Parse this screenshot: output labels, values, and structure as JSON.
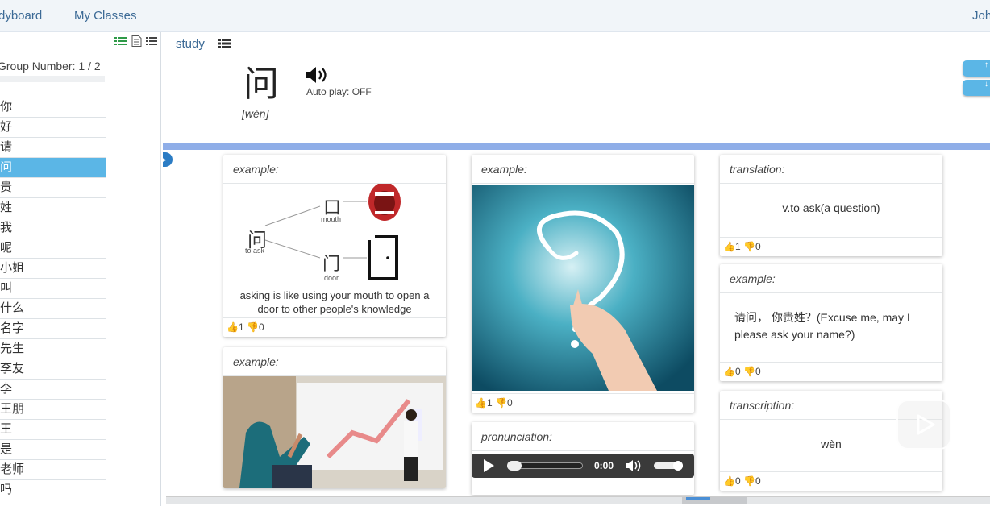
{
  "nav": {
    "dashboard": "dyboard",
    "my_classes": "My Classes",
    "user": "Joh"
  },
  "sidebar": {
    "group_label": "Group Number: 1 / 2",
    "words": [
      "你",
      "好",
      "请",
      "问",
      "贵",
      "姓",
      "我",
      "呢",
      "小姐",
      "叫",
      "什么",
      "名字",
      "先生",
      "李友",
      "李",
      "王朋",
      "王",
      "是",
      "老师",
      "吗"
    ],
    "active_index": 3
  },
  "study": {
    "link": "study",
    "character": "问",
    "pinyin": "[wèn]",
    "autoplay": "Auto play: OFF"
  },
  "cards": {
    "c1": {
      "head": "example:",
      "mouth_label": "mouth",
      "door_label": "door",
      "ask_label": "to ask",
      "char_wen": "问",
      "char_kou": "口",
      "char_men": "门",
      "caption": "asking is like using your mouth to open a door to other people's knowledge",
      "likes": "1",
      "dislikes": "0"
    },
    "c2": {
      "head": "example:"
    },
    "c3": {
      "head": "example:",
      "likes": "1",
      "dislikes": "0"
    },
    "c4": {
      "head": "pronunciation:",
      "time": "0:00"
    },
    "c5": {
      "head": "translation:",
      "text": "v.to ask(a question)",
      "likes": "1",
      "dislikes": "0"
    },
    "c6": {
      "head": "example:",
      "text": "请问， 你贵姓？(Excuse me, may I please ask your name?)",
      "likes": "0",
      "dislikes": "0"
    },
    "c7": {
      "head": "transcription:",
      "text": "wèn",
      "likes": "0",
      "dislikes": "0"
    }
  },
  "colors": {
    "accent": "#5bb6e6",
    "link": "#3c6a96",
    "divider": "#8faee8"
  }
}
